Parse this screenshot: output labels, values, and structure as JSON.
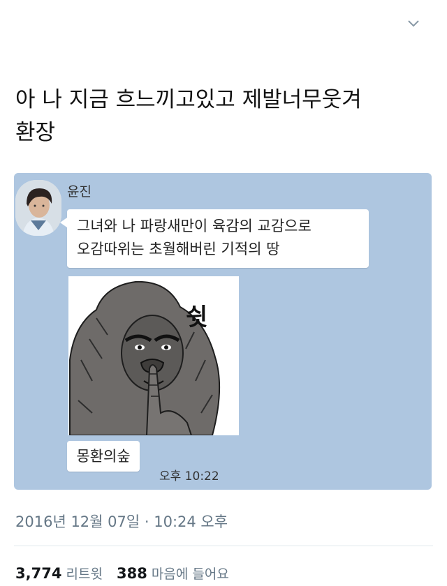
{
  "tweet": {
    "text_line1": "아 나 지금 흐느끼고있고 제발너무웃겨",
    "text_line2": "환장",
    "timestamp": "2016년 12월 07일 · 10:24 오후",
    "retweets": {
      "count": "3,774",
      "label": "리트윗"
    },
    "likes": {
      "count": "388",
      "label": "마음에 들어요"
    }
  },
  "chat": {
    "sender": "윤진",
    "message1_line1": "그녀와 나 파랑새만이 육감의 교감으로",
    "message1_line2": "오감따위는 초월해버린 기적의 땅",
    "sticker_text": "쉿",
    "message2": "몽환의숲",
    "time": "오후 10:22"
  },
  "icons": {
    "menu": "chevron-down-icon"
  },
  "colors": {
    "chat_background": "#aec6e0",
    "muted_text": "#657786"
  }
}
